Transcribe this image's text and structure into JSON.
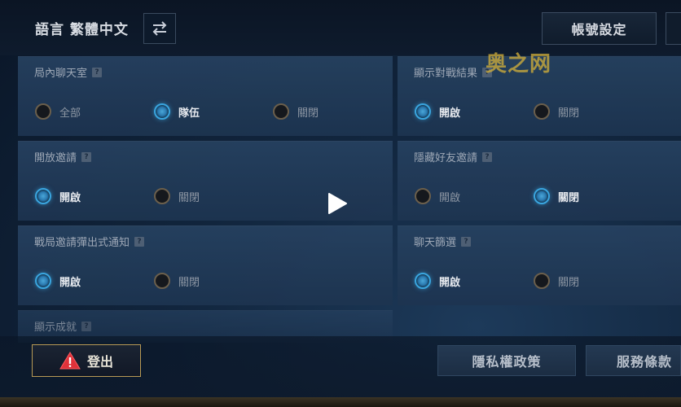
{
  "header": {
    "language_label": "語言 繁體中文",
    "account_settings_label": "帳號設定"
  },
  "watermark": "奥之网",
  "panels": [
    {
      "title": "局內聊天室",
      "options": [
        {
          "label": "全部",
          "selected": false
        },
        {
          "label": "隊伍",
          "selected": true
        },
        {
          "label": "關閉",
          "selected": false
        }
      ]
    },
    {
      "title": "顯示對戰結果",
      "options": [
        {
          "label": "開啟",
          "selected": true
        },
        {
          "label": "關閉",
          "selected": false
        }
      ]
    },
    {
      "title": "開放邀請",
      "options": [
        {
          "label": "開啟",
          "selected": true
        },
        {
          "label": "關閉",
          "selected": false
        }
      ]
    },
    {
      "title": "隱藏好友邀請",
      "options": [
        {
          "label": "開啟",
          "selected": false
        },
        {
          "label": "關閉",
          "selected": true
        }
      ]
    },
    {
      "title": "戰局邀請彈出式通知",
      "options": [
        {
          "label": "開啟",
          "selected": true
        },
        {
          "label": "關閉",
          "selected": false
        }
      ]
    },
    {
      "title": "聊天篩選",
      "options": [
        {
          "label": "開啟",
          "selected": true
        },
        {
          "label": "關閉",
          "selected": false
        }
      ]
    },
    {
      "title": "顯示成就",
      "options": []
    }
  ],
  "footer": {
    "logout_label": "登出",
    "privacy_label": "隱私權政策",
    "terms_label": "服務條款"
  },
  "colors": {
    "accent_blue": "#3aa6e0",
    "panel_bg": "#26405f",
    "warning_red": "#e0323a",
    "gold_border": "#b89a55"
  }
}
